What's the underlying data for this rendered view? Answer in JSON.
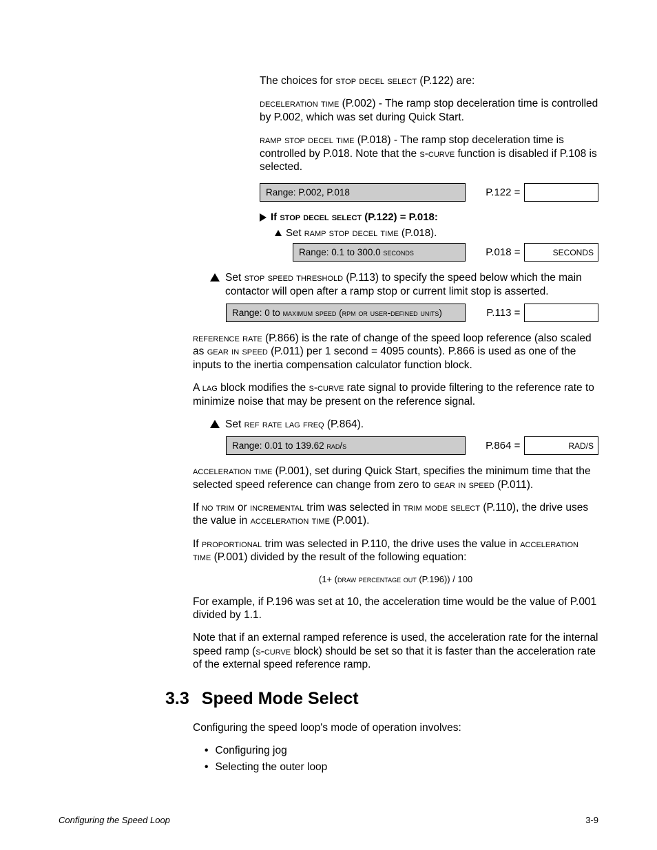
{
  "intro": {
    "p1a": "The choices for ",
    "p1b": "stop decel select",
    "p1c": " (P.122) are:",
    "p2a": "deceleration time",
    "p2b": " (P.002) - The ramp stop deceleration time is controlled by P.002, which was set during Quick Start.",
    "p3a": "ramp stop decel time",
    "p3b": " (P.018) - The ramp stop deceleration time is controlled by P.018. Note that the ",
    "p3c": "s-curve",
    "p3d": " function is disabled if P.108 is selected."
  },
  "row1": {
    "range": "Range: P.002, P.018",
    "label": "P.122 =",
    "unit": ""
  },
  "cond": {
    "head_a": "If ",
    "head_b": "stop decel select",
    "head_c": " (P.122) = P.018:",
    "set_a": "Set ",
    "set_b": "ramp stop decel time",
    "set_c": " (P.018)."
  },
  "row2": {
    "range": "Range: 0.1 to 300.0 seconds",
    "label": "P.018 =",
    "unit": "SECONDS"
  },
  "step1": {
    "a": "Set ",
    "b": "stop speed threshold",
    "c": " (P.113) to specify the speed below which the main contactor will open after a ramp stop or current limit stop is asserted."
  },
  "row3": {
    "range": "Range: 0 to maximum speed (rpm or user-defined units)",
    "label": "P.113 =",
    "unit": ""
  },
  "mid": {
    "p1a": "reference rate",
    "p1b": " (P.866) is the rate of change of the speed loop reference (also scaled as ",
    "p1c": "gear in speed",
    "p1d": " (P.011) per 1 second = 4095 counts). P.866 is used as one of the inputs to the inertia compensation calculator function block.",
    "p2a": "A ",
    "p2b": "lag",
    "p2c": " block modifies the ",
    "p2d": "s-curve",
    "p2e": " rate signal to provide filtering to the reference rate to minimize noise that may be present on the reference signal."
  },
  "step2": {
    "a": "Set ",
    "b": "ref rate lag freq",
    "c": " (P.864)."
  },
  "row4": {
    "range": "Range: 0.01 to 139.62 rad/s",
    "label": "P.864 =",
    "unit": "RAD/S"
  },
  "after": {
    "p1a": "acceleration time",
    "p1b": " (P.001), set during Quick Start, specifies the minimum time that the selected speed reference can change from zero to ",
    "p1c": "gear in speed",
    "p1d": " (P.011).",
    "p2a": "If ",
    "p2b": "no trim",
    "p2c": " or ",
    "p2d": "incremental",
    "p2e": " trim was selected in ",
    "p2f": "trim mode select",
    "p2g": " (P.110), the drive uses the value in ",
    "p2h": "acceleration time",
    "p2i": " (P.001).",
    "p3a": "If ",
    "p3b": "proportional",
    "p3c": " trim was selected in P.110, the drive uses the value in ",
    "p3d": "acceleration time",
    "p3e": " (P.001) divided by the result of the following equation:",
    "eq_a": "(1+ (",
    "eq_b": "draw percentage out",
    "eq_c": " (P.196)) / 100",
    "p4": "For example, if P.196 was set at 10, the acceleration time would be the value of P.001 divided by 1.1.",
    "p5a": "Note that if an external ramped reference is used, the acceleration rate for the internal speed ramp (",
    "p5b": "s-curve",
    "p5c": " block) should be set so that it is faster than the acceleration rate of the external speed reference ramp."
  },
  "heading": {
    "num": "3.3",
    "title": "Speed Mode Select"
  },
  "sect": {
    "intro": "Configuring the speed loop's mode of operation involves:",
    "b1": "Configuring jog",
    "b2": "Selecting the outer loop"
  },
  "footer": {
    "left": "Configuring the Speed Loop",
    "right": "3-9"
  }
}
